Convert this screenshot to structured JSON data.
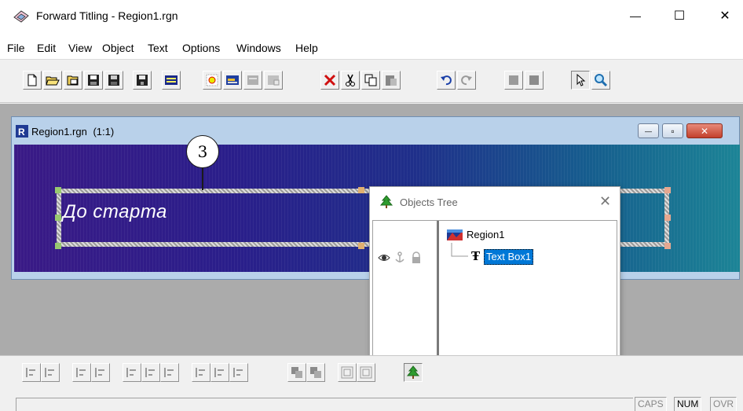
{
  "window": {
    "title": "Forward Titling - Region1.rgn",
    "minimize_glyph": "—",
    "maximize_glyph": "☐",
    "close_glyph": "✕"
  },
  "menu": [
    "File",
    "Edit",
    "View",
    "Object",
    "Text",
    "Options",
    "Windows",
    "Help"
  ],
  "toolbar_icons": [
    "new-file-icon",
    "open-folder-icon",
    "open-template-icon",
    "save-icon",
    "save-all-icon",
    "save-disk-icon",
    "region-properties-icon",
    "add-object-icon",
    "object-disabled-icon",
    "object-disabled-2-icon",
    "delete-icon",
    "cut-icon",
    "copy-icon",
    "paste-icon",
    "undo-icon",
    "redo-icon",
    "disabled-block-icon",
    "disabled-block-2-icon",
    "select-arrow-icon",
    "zoom-icon"
  ],
  "child_window": {
    "title": "Region1.rgn",
    "zoom": "(1:1)",
    "minimize_glyph": "—",
    "restore_glyph": "▫",
    "close_glyph": "✕"
  },
  "canvas": {
    "text": "До старта"
  },
  "callout": {
    "number": "3"
  },
  "objects_tree": {
    "title": "Objects Tree",
    "close_glyph": "✕",
    "root": "Region1",
    "child": "Text Box1",
    "flags": [
      "eye-icon",
      "anchor-icon",
      "lock-icon"
    ]
  },
  "align_toolbar_icons": [
    "align-left-icon",
    "align-center-horizontal-icon",
    "align-right-icon",
    "align-top-icon",
    "align-middle-icon",
    "align-bottom-icon",
    "distribute-horizontal-icon",
    "distribute-vertical-icon",
    "same-width-icon",
    "same-height-icon",
    "bring-front-icon",
    "send-back-icon",
    "group-icon",
    "ungroup-icon",
    "objects-tree-toggle-icon"
  ],
  "status": {
    "caps": "CAPS",
    "num": "NUM",
    "ovr": "OVR"
  },
  "colors": {
    "selection": "#0078d7",
    "tree_green": "#2e9b2e",
    "delete_red": "#d01010"
  }
}
